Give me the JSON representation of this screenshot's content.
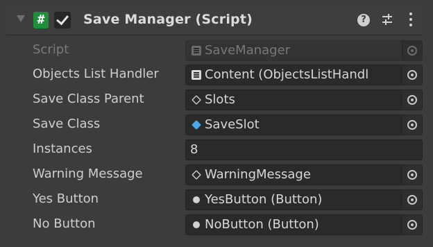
{
  "header": {
    "title": "Save Manager (Script)",
    "enabled": true,
    "icons": [
      "foldout-arrow-icon",
      "script-icon",
      "help-icon",
      "preset-icon",
      "context-menu-icon"
    ]
  },
  "fields": [
    {
      "label": "Script",
      "value": "SaveManager",
      "icon": "script-icon",
      "disabled": true,
      "picker": true
    },
    {
      "label": "Objects List Handler",
      "value": "Content (ObjectsListHandl",
      "icon": "script-icon",
      "disabled": false,
      "picker": true
    },
    {
      "label": "Save Class Parent",
      "value": "Slots",
      "icon": "gameobject-icon",
      "disabled": false,
      "picker": true
    },
    {
      "label": "Save Class",
      "value": "SaveSlot",
      "icon": "prefab-icon",
      "disabled": false,
      "picker": true
    },
    {
      "label": "Instances",
      "value": "8",
      "icon": "",
      "disabled": false,
      "picker": false
    },
    {
      "label": "Warning Message",
      "value": "WarningMessage",
      "icon": "gameobject-icon",
      "disabled": false,
      "picker": true
    },
    {
      "label": "Yes Button",
      "value": "YesButton (Button)",
      "icon": "component-icon",
      "disabled": false,
      "picker": true
    },
    {
      "label": "No Button",
      "value": "NoButton (Button)",
      "icon": "component-icon",
      "disabled": false,
      "picker": true
    }
  ],
  "colors": {
    "background": "#3c3c3c",
    "field": "#2a2a2a",
    "script_icon": "#1f8e3a",
    "prefab_icon": "#4aa8ec"
  }
}
